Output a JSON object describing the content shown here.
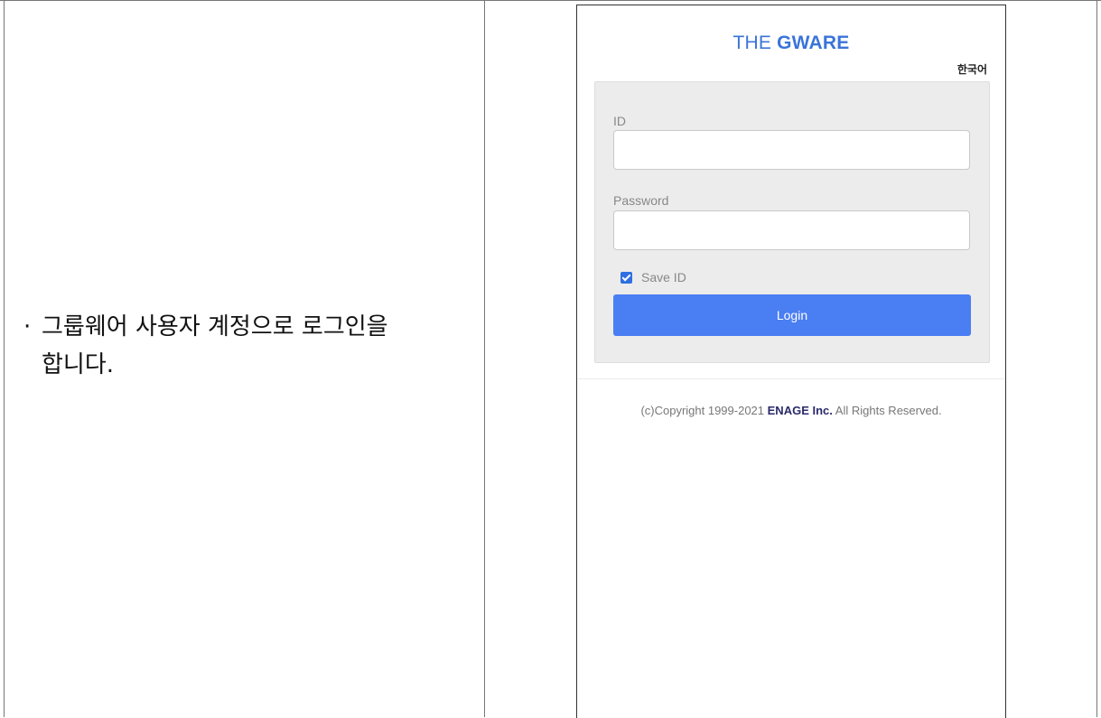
{
  "instruction": {
    "bullet": "·",
    "text": "그룹웨어 사용자 계정으로 로그인을\n합니다."
  },
  "login_page": {
    "logo_prefix": "THE ",
    "logo_main": "GWARE",
    "language": "한국어",
    "id_label": "ID",
    "id_value": "",
    "password_label": "Password",
    "password_value": "",
    "save_id_label": "Save ID",
    "save_id_checked": true,
    "login_button": "Login",
    "copyright_prefix": "(c)Copyright 1999-2021 ",
    "copyright_company": "ENAGE Inc.",
    "copyright_suffix": " All Rights Reserved."
  },
  "colors": {
    "accent": "#4a7ef3",
    "logo": "#3b74d8",
    "panel": "#ececec"
  }
}
